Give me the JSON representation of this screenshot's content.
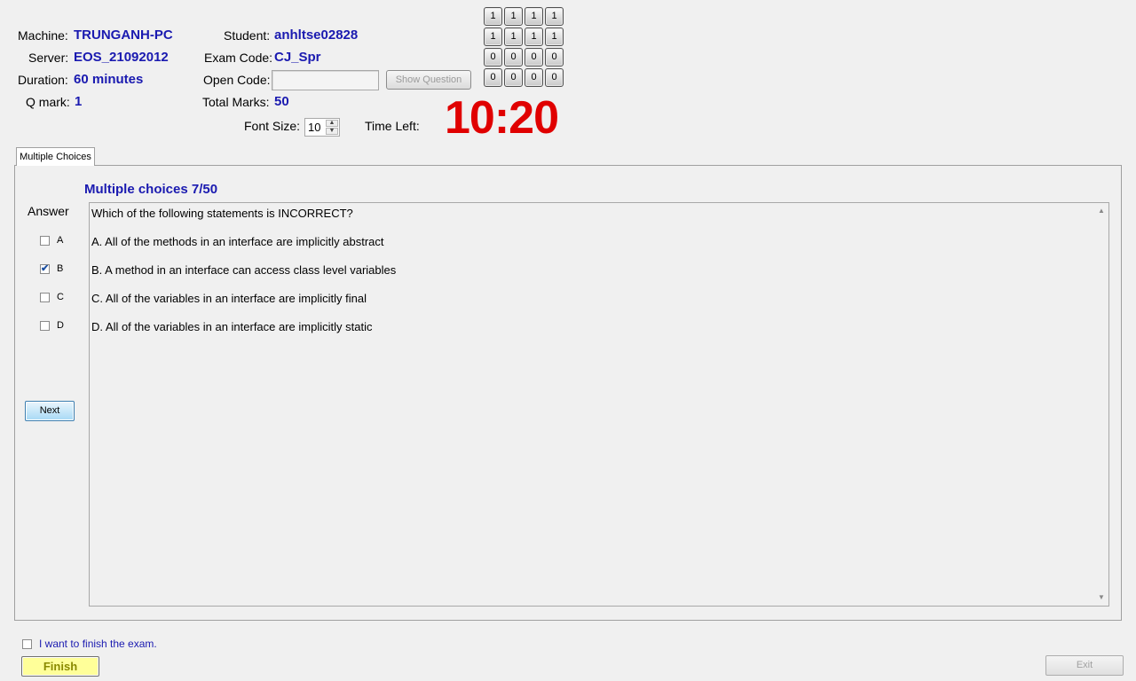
{
  "info": {
    "machine_label": "Machine:",
    "machine_value": "TRUNGANH-PC",
    "server_label": "Server:",
    "server_value": "EOS_21092012",
    "duration_label": "Duration:",
    "duration_value": "60 minutes",
    "qmark_label": "Q mark:",
    "qmark_value": "1",
    "student_label": "Student:",
    "student_value": "anhltse02828",
    "exam_code_label": "Exam Code:",
    "exam_code_value": "CJ_Spr",
    "open_code_label": "Open Code:",
    "open_code_value": "",
    "show_question_label": "Show Question",
    "total_marks_label": "Total Marks:",
    "total_marks_value": "50",
    "font_size_label": "Font Size:",
    "font_size_value": "10",
    "time_left_label": "Time Left:",
    "time_left_value": "10:20"
  },
  "answer_grid": [
    [
      "1",
      "1",
      "1",
      "1"
    ],
    [
      "1",
      "1",
      "1",
      "1"
    ],
    [
      "0",
      "0",
      "0",
      "0"
    ],
    [
      "0",
      "0",
      "0",
      "0"
    ]
  ],
  "tab": {
    "label": "Multiple Choices"
  },
  "question": {
    "title": "Multiple choices 7/50",
    "text": "Which of the following statements is INCORRECT?",
    "options": [
      "A.  All of the methods in an interface are implicitly abstract",
      "B.  A method in an interface can access class level variables",
      "C.  All of the variables in an interface are implicitly final",
      "D.  All of the variables in an interface are implicitly static"
    ]
  },
  "answer": {
    "heading": "Answer",
    "choices": [
      {
        "label": "A",
        "checked": false
      },
      {
        "label": "B",
        "checked": true
      },
      {
        "label": "C",
        "checked": false
      },
      {
        "label": "D",
        "checked": false
      }
    ],
    "next_label": "Next"
  },
  "footer": {
    "finish_confirm_label": "I want to finish the exam.",
    "finish_label": "Finish",
    "exit_label": "Exit"
  },
  "colors": {
    "value_blue": "#1a1ab0",
    "timer_red": "#e00000",
    "finish_yellow": "#ffff99"
  }
}
